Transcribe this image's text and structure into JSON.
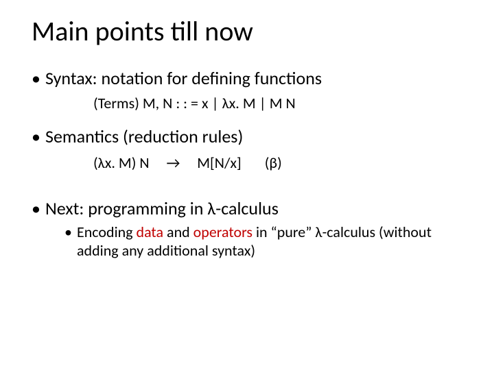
{
  "title": "Main points till now",
  "bullets": {
    "syntax": "Syntax: notation for defining functions",
    "grammar": "(Terms)  M, N  : : =  x  |  λx. M  |  M N",
    "semantics": "Semantics (reduction rules)",
    "reduction_lhs": "(λx. M) N",
    "reduction_arrow": "→",
    "reduction_rhs": "M[N/x]",
    "reduction_label": "(β)",
    "next": "Next: programming in λ-calculus",
    "sub_pre": "Encoding ",
    "sub_data": "data",
    "sub_and": " and ",
    "sub_ops": "operators",
    "sub_post": " in “pure” λ-calculus (without adding any additional syntax)"
  }
}
